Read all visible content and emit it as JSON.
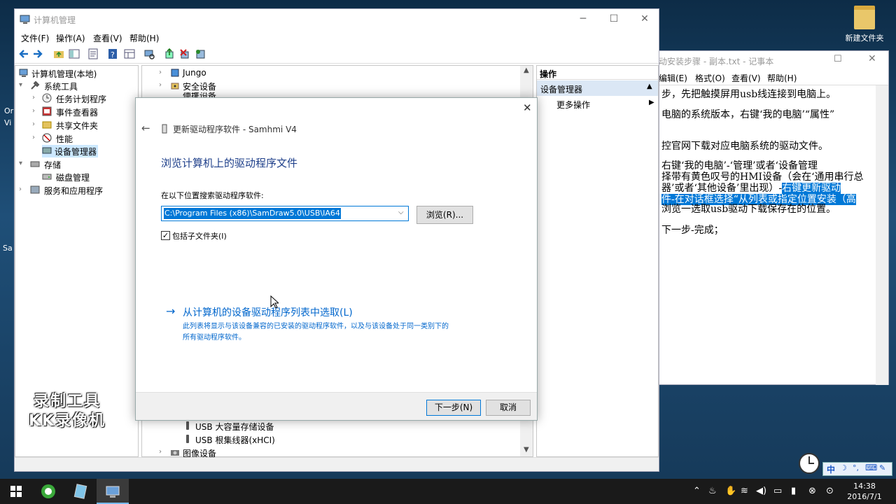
{
  "desktop": {
    "icon_label": "新建文件夹",
    "left_fragments": [
      "Or",
      "Vi",
      "Sa"
    ]
  },
  "mmc": {
    "title": "计算机管理",
    "menu": [
      "文件(F)",
      "操作(A)",
      "查看(V)",
      "帮助(H)"
    ],
    "tree": [
      {
        "label": "计算机管理(本地)",
        "level": 0,
        "exp": ""
      },
      {
        "label": "系统工具",
        "level": 1,
        "exp": "▾"
      },
      {
        "label": "任务计划程序",
        "level": 2,
        "exp": "›"
      },
      {
        "label": "事件查看器",
        "level": 2,
        "exp": "›"
      },
      {
        "label": "共享文件夹",
        "level": 2,
        "exp": "›"
      },
      {
        "label": "性能",
        "level": 2,
        "exp": "›"
      },
      {
        "label": "设备管理器",
        "level": 2,
        "exp": "",
        "selected": true
      },
      {
        "label": "存储",
        "level": 1,
        "exp": "▾"
      },
      {
        "label": "磁盘管理",
        "level": 2,
        "exp": ""
      },
      {
        "label": "服务和应用程序",
        "level": 1,
        "exp": "›"
      }
    ],
    "devices_top": [
      "Jungo",
      "安全设备",
      "便携设备"
    ],
    "devices_bottom": [
      "USB 大容量存储设备",
      "USB 根集线器(xHCI)",
      "图像设备"
    ],
    "actions": {
      "header": "操作",
      "section": "设备管理器",
      "more": "更多操作"
    }
  },
  "notepad": {
    "title": "动安装步骤 - 副本.txt - 记事本",
    "menu": [
      "编辑(E)",
      "格式(O)",
      "查看(V)",
      "帮助(H)"
    ],
    "lines": [
      {
        "text": "步，先把触摸屏用usb线连接到电脑上。"
      },
      {
        "text": "电脑的系统版本，右键‘我的电脑’“属性”"
      },
      {
        "text": ""
      },
      {
        "text": "控官网下载对应电脑系统的驱动文件。"
      },
      {
        "text": ""
      },
      {
        "text": " 右键‘我的电脑’-‘管理’或者‘设备管理"
      },
      {
        "text": "择带有黄色叹号的HMI设备（会在‘通用串行总"
      },
      {
        "pre": "器’或者‘其他设备’里出现）-",
        "hl": "右键更新驱动"
      },
      {
        "hl": "件-在对话框选择“从列表或指定位置安装（高"
      },
      {
        "text": "浏览一选取usb驱动下载保存在的位置。"
      },
      {
        "text": ""
      },
      {
        "text": " 下一步-完成；"
      }
    ]
  },
  "dialog": {
    "title": "更新驱动程序软件 - Samhmi V4",
    "heading": "浏览计算机上的驱动程序文件",
    "search_label": "在以下位置搜索驱动程序软件:",
    "path_value": "C:\\Program Files (x86)\\SamDraw5.0\\USB\\IA64",
    "browse_label": "浏览(R)...",
    "include_subfolders": "包括子文件夹(I)",
    "pick_link": "从计算机的设备驱动程序列表中选取(L)",
    "pick_desc_1": "此列表将显示与该设备兼容的已安装的驱动程序软件，以及与该设备处于同一类别下的",
    "pick_desc_2": "所有驱动程序软件。",
    "next_label": "下一步(N)",
    "cancel_label": "取消"
  },
  "watermark": {
    "line1": "录制工具",
    "line2": "KK录像机"
  },
  "taskbar": {
    "time": "14:38",
    "date": "2016/7/1"
  },
  "ime": {
    "lang": "中"
  },
  "colors": {
    "accent": "#0078d7",
    "link": "#0066cc",
    "selection": "#cce8ff"
  }
}
